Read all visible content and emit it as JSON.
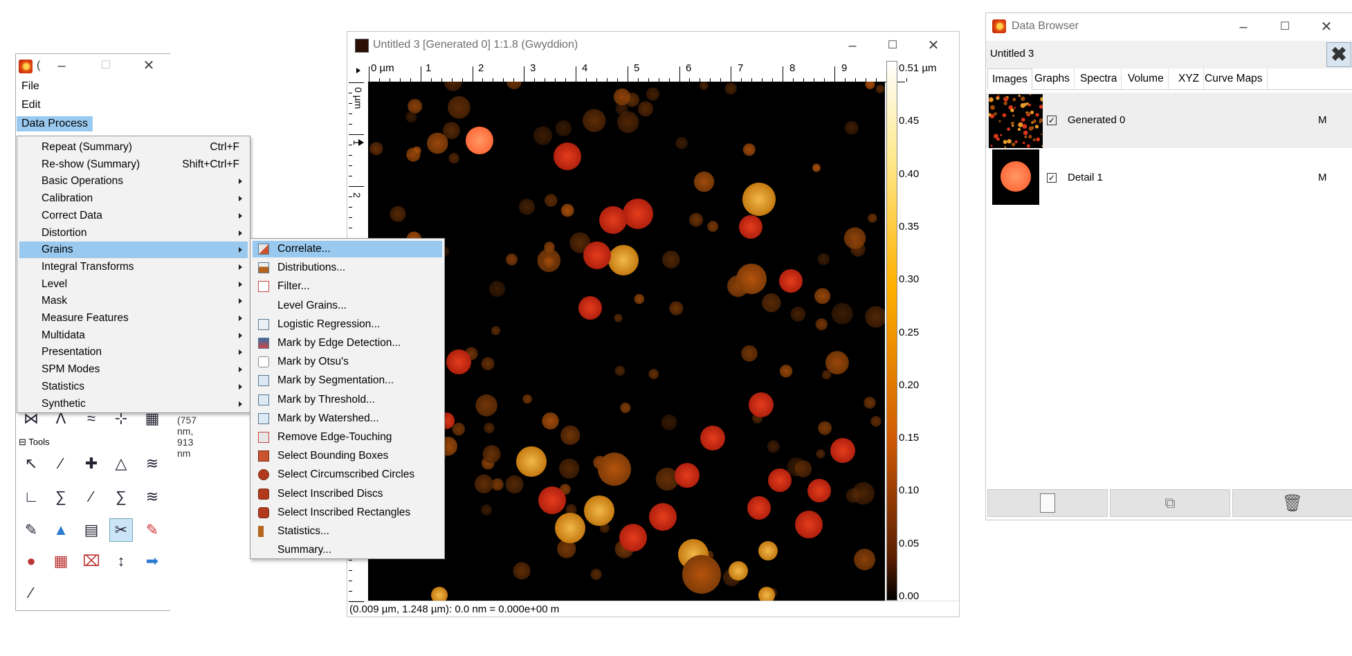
{
  "toolbox": {
    "title": "(",
    "menus": [
      "File",
      "Edit",
      "Data Process"
    ],
    "coords_text": "(757 nm, 913 nm",
    "tools_header": "Tools"
  },
  "data_process_menu": {
    "items": [
      {
        "label": "Repeat (Summary)",
        "accel": "Ctrl+F"
      },
      {
        "label": "Re-show (Summary)",
        "accel": "Shift+Ctrl+F"
      },
      {
        "label": "Basic Operations"
      },
      {
        "label": "Calibration"
      },
      {
        "label": "Correct Data"
      },
      {
        "label": "Distortion"
      },
      {
        "label": "Grains"
      },
      {
        "label": "Integral Transforms"
      },
      {
        "label": "Level"
      },
      {
        "label": "Mask"
      },
      {
        "label": "Measure Features"
      },
      {
        "label": "Multidata"
      },
      {
        "label": "Presentation"
      },
      {
        "label": "SPM Modes"
      },
      {
        "label": "Statistics"
      },
      {
        "label": "Synthetic"
      }
    ]
  },
  "grains_menu": {
    "items": [
      "Correlate...",
      "Distributions...",
      "Filter...",
      "Level Grains...",
      "Logistic Regression...",
      "Mark by Edge Detection...",
      "Mark by Otsu's",
      "Mark by Segmentation...",
      "Mark by Threshold...",
      "Mark by Watershed...",
      "Remove Edge-Touching",
      "Select Bounding Boxes",
      "Select Circumscribed Circles",
      "Select Inscribed Discs",
      "Select Inscribed Rectangles",
      "Statistics...",
      "Summary..."
    ]
  },
  "data_window": {
    "title": "Untitled 3 [Generated 0] 1:1.8 (Gwyddion)",
    "x_ticks": [
      "0 µm",
      "1",
      "2",
      "3",
      "4",
      "5",
      "6",
      "7",
      "8",
      "9"
    ],
    "y_ticks": [
      "0 µm",
      "1",
      "2"
    ],
    "colorbar_labels": [
      "0.51 µm",
      "0.45",
      "0.40",
      "0.35",
      "0.30",
      "0.25",
      "0.20",
      "0.15",
      "0.10",
      "0.05",
      "0.00"
    ],
    "status": "(0.009 µm, 1.248 µm): 0.0 nm = 0.000e+00 m"
  },
  "data_browser": {
    "title": "Data Browser",
    "file": "Untitled 3",
    "tabs": [
      "Images",
      "Graphs",
      "Spectra",
      "Volume",
      "XYZ",
      "Curve Maps"
    ],
    "rows": [
      {
        "name": "Generated 0",
        "flag": "M"
      },
      {
        "name": "Detail 1",
        "flag": "M"
      }
    ]
  }
}
